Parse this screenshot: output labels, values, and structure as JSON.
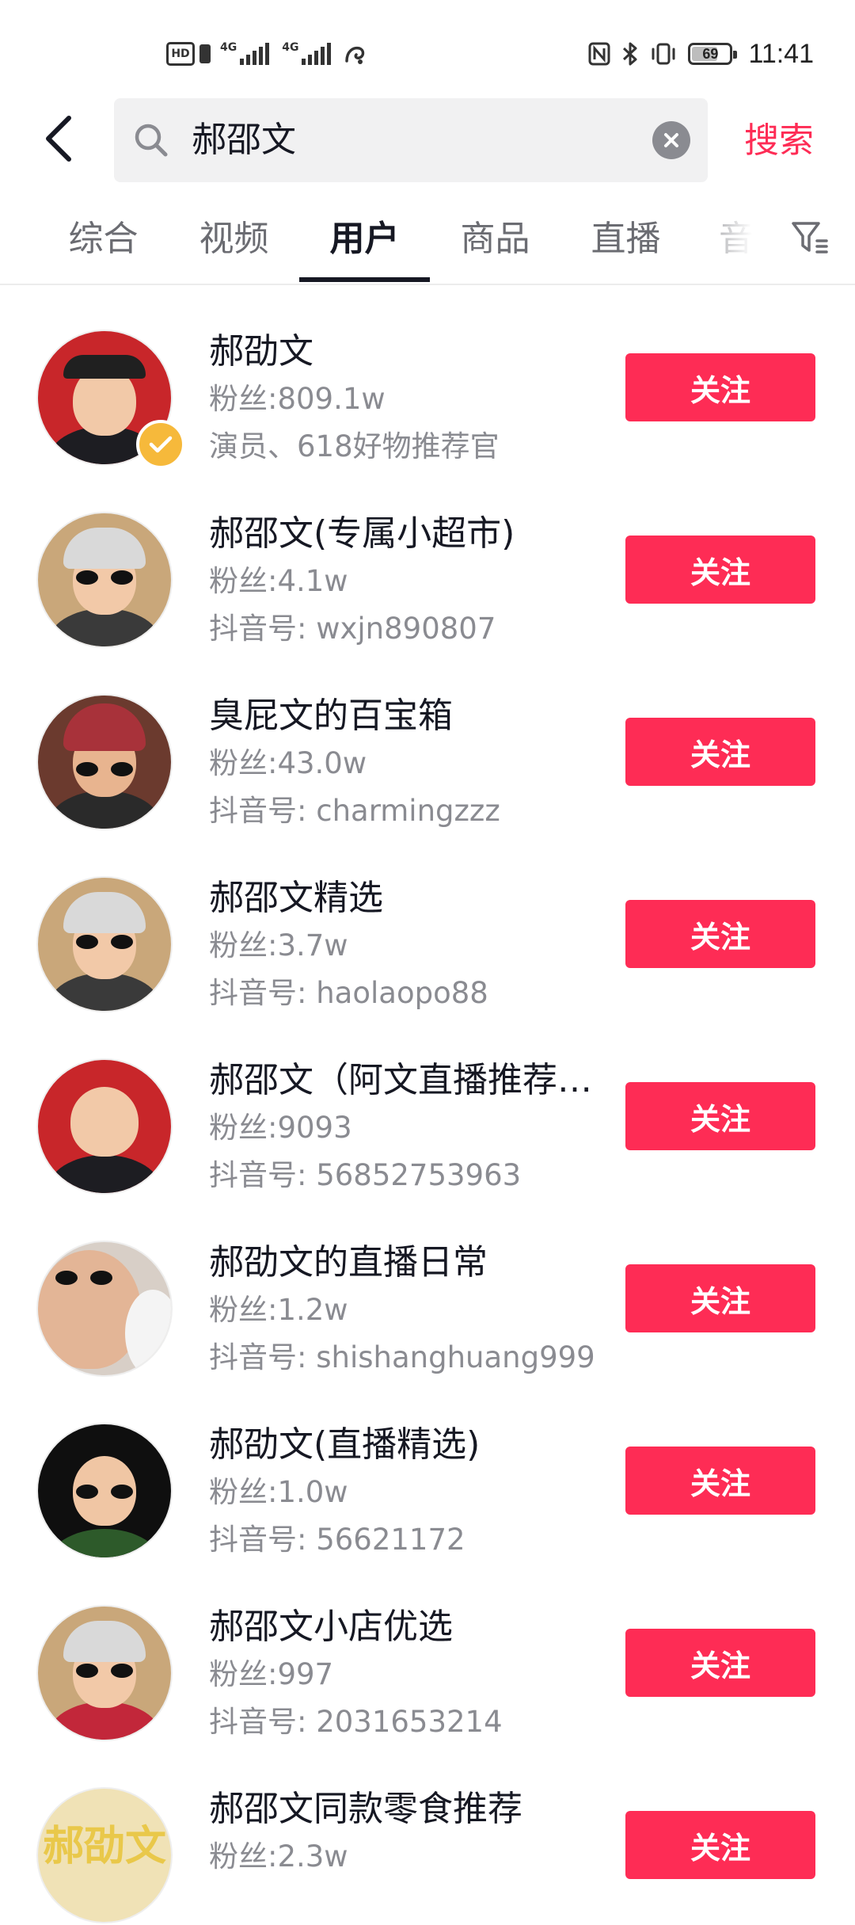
{
  "status_bar": {
    "hd_label": "HD",
    "sim1_network": "4G",
    "sim2_network": "4G",
    "battery_level": "69",
    "battery_fraction": 0.69,
    "time": "11:41"
  },
  "search": {
    "query": "郝邵文",
    "submit_label": "搜索",
    "back_icon": "chevron-left-icon",
    "search_icon": "magnifier-icon",
    "clear_icon": "clear-x-icon"
  },
  "tabs": [
    {
      "label": "综合"
    },
    {
      "label": "视频"
    },
    {
      "label": "用户"
    },
    {
      "label": "商品"
    },
    {
      "label": "直播"
    },
    {
      "label": "音"
    }
  ],
  "active_tab": "用户",
  "filter_icon": "filter-icon",
  "colors": {
    "accent": "#fe2c55",
    "text_primary": "#161823",
    "text_secondary": "#8a8b91",
    "verified": "#f6b93b"
  },
  "users": [
    {
      "name": "郝劭文",
      "fans": "粉丝:809.1w",
      "sub": "演员、618好物推荐官",
      "verified": true,
      "follow_label": "关注"
    },
    {
      "name": "郝邵文(专属小超市)",
      "fans": "粉丝:4.1w",
      "sub": "抖音号: wxjn890807",
      "verified": false,
      "follow_label": "关注"
    },
    {
      "name": "臭屁文的百宝箱",
      "fans": "粉丝:43.0w",
      "sub": "抖音号: charmingzzz",
      "verified": false,
      "follow_label": "关注"
    },
    {
      "name": "郝邵文精选",
      "fans": "粉丝:3.7w",
      "sub": "抖音号: haolaopo88",
      "verified": false,
      "follow_label": "关注"
    },
    {
      "name": "郝邵文（阿文直播推荐…",
      "fans": "粉丝:9093",
      "sub": "抖音号: 56852753963",
      "verified": false,
      "follow_label": "关注"
    },
    {
      "name": "郝劭文的直播日常",
      "fans": "粉丝:1.2w",
      "sub": "抖音号: shishanghuang999",
      "verified": false,
      "follow_label": "关注"
    },
    {
      "name": "郝劭文(直播精选)",
      "fans": "粉丝:1.0w",
      "sub": "抖音号: 56621172",
      "verified": false,
      "follow_label": "关注"
    },
    {
      "name": "郝邵文小店优选",
      "fans": "粉丝:997",
      "sub": "抖音号: 2031653214",
      "verified": false,
      "follow_label": "关注"
    },
    {
      "name": "郝邵文同款零食推荐",
      "fans": "粉丝:2.3w",
      "sub": "",
      "verified": false,
      "follow_label": "关注"
    }
  ],
  "avatar_logo_text": "郝劭文"
}
